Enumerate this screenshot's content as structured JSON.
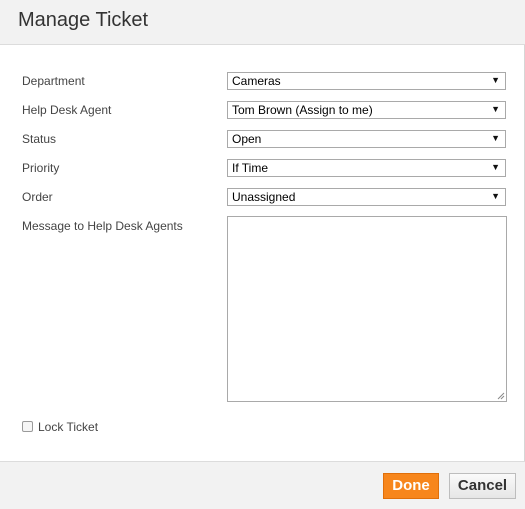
{
  "dialog": {
    "title": "Manage Ticket"
  },
  "form": {
    "department": {
      "label": "Department",
      "value": "Cameras"
    },
    "agent": {
      "label": "Help Desk Agent",
      "value": "Tom Brown (Assign to me)"
    },
    "status": {
      "label": "Status",
      "value": "Open"
    },
    "priority": {
      "label": "Priority",
      "value": "If Time"
    },
    "order": {
      "label": "Order",
      "value": "Unassigned"
    },
    "message": {
      "label": "Message to Help Desk Agents",
      "value": ""
    },
    "lock": {
      "label": "Lock Ticket",
      "checked": false
    }
  },
  "icons": {
    "dropdown": "chevron-down-icon",
    "checkbox": "checkbox-icon",
    "resize": "resize-grip-icon"
  },
  "footer": {
    "done_label": "Done",
    "cancel_label": "Cancel"
  },
  "colors": {
    "done_button": "#f7861c",
    "header_bg": "#f2f2f2",
    "footer_bg": "#f2f2f2"
  }
}
